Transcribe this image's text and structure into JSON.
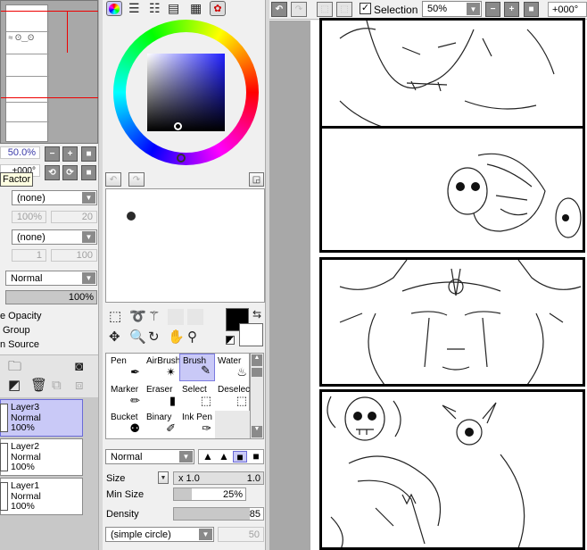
{
  "navigator": {
    "zoom": "50.0%",
    "angle": "+000°",
    "tooltip": "Factor"
  },
  "layer_props": {
    "texture": "(none)",
    "texture_pct": "100%",
    "texture_val": "20",
    "effect": "(none)",
    "effect_a": "1",
    "effect_b": "100",
    "blend_mode": "Normal",
    "opacity": "100%",
    "options": [
      "e Opacity",
      "Group",
      "n Source"
    ]
  },
  "layers": [
    {
      "name": "Layer3",
      "mode": "Normal",
      "opacity": "100%",
      "selected": true
    },
    {
      "name": "Layer2",
      "mode": "Normal",
      "opacity": "100%",
      "selected": false
    },
    {
      "name": "Layer1",
      "mode": "Normal",
      "opacity": "100%",
      "selected": false
    }
  ],
  "tools": [
    {
      "label": "Pen",
      "icon": "pen-icon",
      "glyph": "✒"
    },
    {
      "label": "AirBrush",
      "icon": "airbrush-icon",
      "glyph": "✴"
    },
    {
      "label": "Brush",
      "icon": "brush-icon",
      "glyph": "✎"
    },
    {
      "label": "Water",
      "icon": "water-icon",
      "glyph": "♨"
    },
    {
      "label": "Marker",
      "icon": "marker-icon",
      "glyph": "✏"
    },
    {
      "label": "Eraser",
      "icon": "eraser-icon",
      "glyph": "▮"
    },
    {
      "label": "Select",
      "icon": "select-icon",
      "glyph": "⬚"
    },
    {
      "label": "Deselect",
      "icon": "deselect-icon",
      "glyph": "⬚"
    },
    {
      "label": "Bucket",
      "icon": "bucket-icon",
      "glyph": "⚉"
    },
    {
      "label": "Binary",
      "icon": "binary-icon",
      "glyph": "✐"
    },
    {
      "label": "Ink Pen",
      "icon": "ink-pen-icon",
      "glyph": "✑"
    },
    {
      "label": "",
      "icon": "",
      "glyph": ""
    }
  ],
  "brush": {
    "blend": "Normal",
    "size_label": "Size",
    "size_mult": "x 1.0",
    "size_val": "1.0",
    "min_size_label": "Min Size",
    "min_size_val": "25%",
    "min_size_level": 0.25,
    "density_label": "Density",
    "density_val": "85",
    "density_level": 0.85,
    "shape": "(simple circle)",
    "shape_val": "50"
  },
  "toolbar": {
    "selection_label": "Selection",
    "selection_checked": true,
    "zoom": "50%",
    "rotation": "+000°"
  },
  "colors": {
    "selected_bg": "#c9c9f7",
    "primary": "#000000",
    "secondary": "#ffffff"
  }
}
